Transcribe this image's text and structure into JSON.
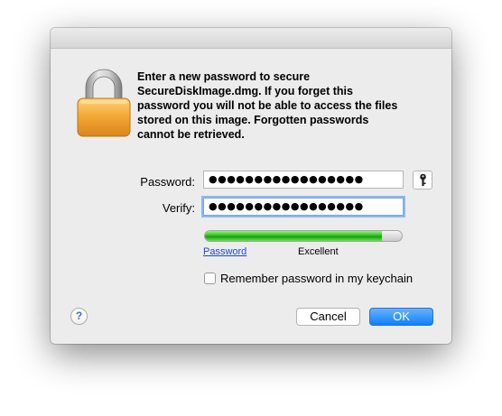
{
  "dialog": {
    "message": "Enter a new password to secure SecureDiskImage.dmg.  If you forget this password you will not be able to access the files stored on this image. Forgotten passwords cannot be retrieved.",
    "icon": "lock-icon"
  },
  "form": {
    "password_label": "Password:",
    "password_value": "●●●●●●●●●●●●●●●●●",
    "verify_label": "Verify:",
    "verify_value": "●●●●●●●●●●●●●●●●●",
    "key_button_icon": "key-icon"
  },
  "strength": {
    "link_label": "Password",
    "quality_label": "Excellent",
    "fraction": 0.9,
    "color": "#2ec11e"
  },
  "keychain": {
    "label": "Remember password in my keychain",
    "checked": false
  },
  "buttons": {
    "help_label": "?",
    "cancel_label": "Cancel",
    "ok_label": "OK"
  },
  "colors": {
    "accent": "#0d81ff",
    "link": "#1a4bc4",
    "lock_body": "#f0a431"
  }
}
